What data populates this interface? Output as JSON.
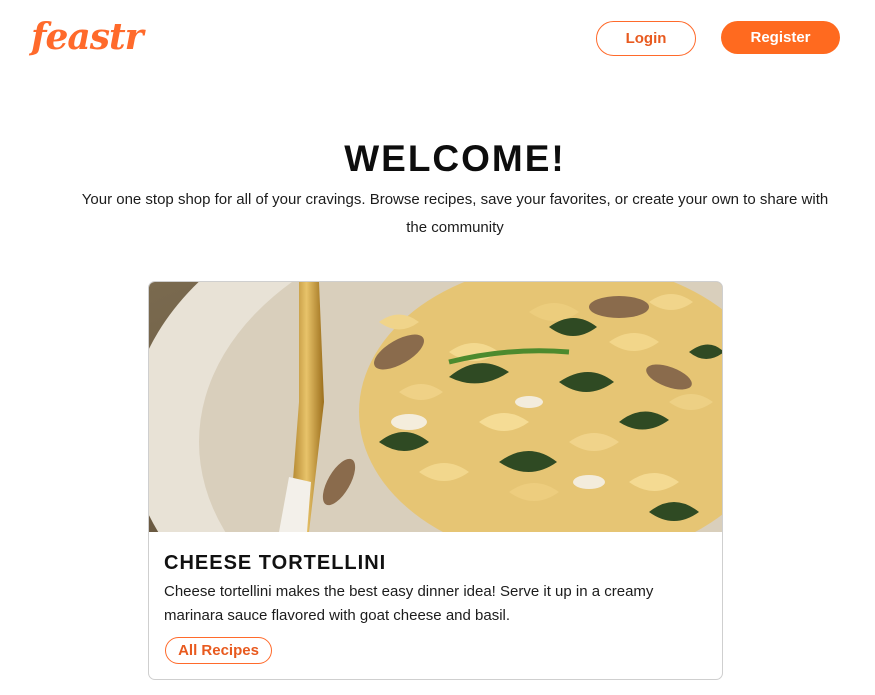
{
  "brand": {
    "logo_text": "feastr",
    "accent_color": "#ff6a1f"
  },
  "header": {
    "login_label": "Login",
    "register_label": "Register"
  },
  "hero": {
    "title": "WELCOME!",
    "subtitle": "Your one stop shop for all of your cravings. Browse recipes, save your favorites, or create your own to share with the community"
  },
  "featured_recipe": {
    "image_icon": "pasta-dish-photo",
    "title": "CHEESE TORTELLINI",
    "description": "Cheese tortellini makes the best easy dinner idea! Serve it up in a creamy marinara sauce flavored with goat cheese and basil.",
    "button_label": "All Recipes"
  }
}
